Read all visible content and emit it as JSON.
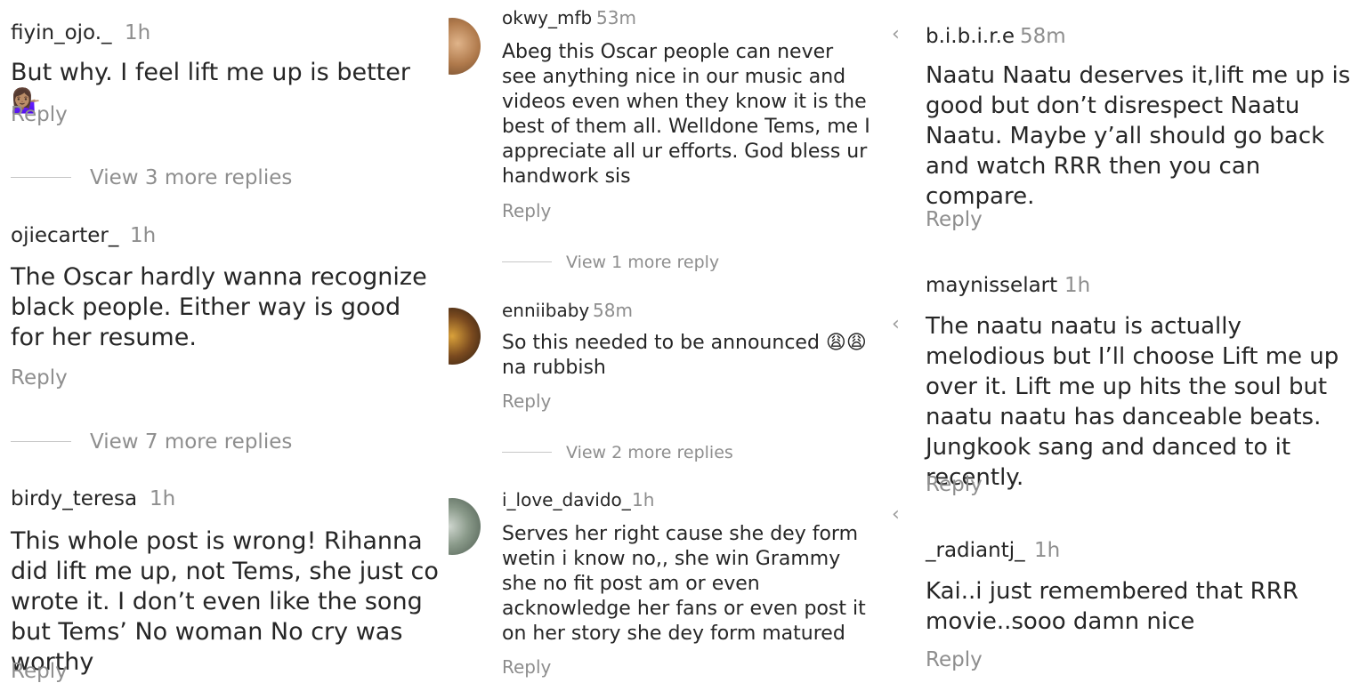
{
  "col1": [
    {
      "user": "fiyin_ojo._",
      "time": "1h",
      "text": "But why. I feel lift me up is better 💁🏽‍♀️",
      "reply": "Reply",
      "view": "View 3 more replies"
    },
    {
      "user": "ojiecarter_",
      "time": "1h",
      "text": "The Oscar hardly wanna recognize black people. Either way is good for her resume.",
      "reply": "Reply",
      "view": "View 7 more replies"
    },
    {
      "user": "birdy_teresa",
      "time": "1h",
      "text": "This whole post is wrong! Rihanna did lift me up, not Tems, she just co wrote it. I don’t even like the song but Tems’ No woman No cry was worthy",
      "reply": "Reply"
    }
  ],
  "col2": [
    {
      "user": "okwy_mfb",
      "time": "53m",
      "text": "Abeg this Oscar people can never see anything nice in our music and videos even when they know it is the best of them all. Welldone Tems, me I appreciate all ur efforts.  God bless ur handwork sis",
      "reply": "Reply",
      "view": "View 1 more reply"
    },
    {
      "user": "enniibaby",
      "time": "58m",
      "text": "So this needed to be announced 😩😩 na rubbish",
      "reply": "Reply",
      "view": "View 2 more replies"
    },
    {
      "user": "i_love_davido_",
      "time": "1h",
      "text": "Serves her right cause she dey form wetin i know no,, she win Grammy she no fit post am or even acknowledge her fans or even post it on her story she dey form matured",
      "reply": "Reply"
    }
  ],
  "col3": [
    {
      "user": "b.i.b.i.r.e",
      "time": "58m",
      "text": "Naatu Naatu deserves it,lift me up is good but don’t disrespect Naatu Naatu. Maybe y’all should go back and watch RRR then you can compare.",
      "reply": "Reply"
    },
    {
      "user": "maynisselart",
      "time": "1h",
      "text": "The naatu naatu is actually melodious but I’ll choose Lift me up over it. Lift me up hits the soul but naatu naatu has danceable beats. Jungkook sang and danced to it recently.",
      "reply": "Reply"
    },
    {
      "user": "_radiantj_",
      "time": "1h",
      "text": "Kai..i just remembered that RRR movie..sooo damn nice",
      "reply": "Reply"
    }
  ],
  "colors": {
    "text": "#262626",
    "muted": "#8e8e8e",
    "divider": "#c7c7c7"
  }
}
